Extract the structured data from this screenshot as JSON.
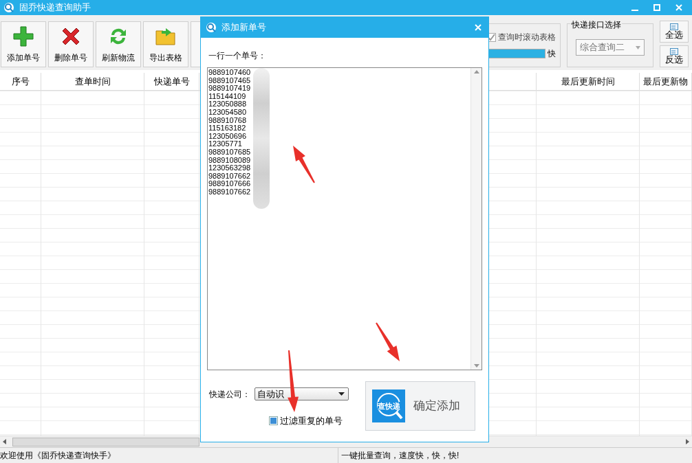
{
  "window": {
    "title": "固乔快递查询助手"
  },
  "toolbar": {
    "buttons": [
      {
        "label": "添加单号",
        "kind": "add"
      },
      {
        "label": "删除单号",
        "kind": "delete"
      },
      {
        "label": "刷新物流",
        "kind": "refresh"
      },
      {
        "label": "导出表格",
        "kind": "export"
      }
    ]
  },
  "options": {
    "scroll_checkbox": {
      "label": "查询时滚动表格",
      "checked": true
    },
    "speed": {
      "level": 1,
      "label": "快"
    },
    "api_group": {
      "title": "快递接口选择",
      "value": "综合查询二"
    },
    "select_buttons": [
      {
        "label": "全选"
      },
      {
        "label": "反选"
      }
    ]
  },
  "table": {
    "columns": [
      "序号",
      "查单时间",
      "快递单号",
      "",
      "最后更新时间",
      "最后更新物"
    ]
  },
  "dialog": {
    "title": "添加新单号",
    "prompt": "一行一个单号：",
    "tracking_numbers": [
      "9889107460",
      "9889107465",
      "9889107419",
      "115144109",
      "123050888",
      "123054580",
      "988910768",
      "115163182",
      "123050696",
      "12305771",
      "9889107685",
      "9889108089",
      "1230563298",
      "9889107662",
      "9889107666",
      "9889107662"
    ],
    "company_label": "快递公司：",
    "company_value": "自动识",
    "dedupe": {
      "label": "过滤重复的单号",
      "checked": true
    },
    "confirm_button": {
      "icon_text": "查快递",
      "label": "确定添加"
    }
  },
  "status_bar": [
    "欢迎使用《固乔快递查询快手》",
    "一键批量查询，速度快，快，快!"
  ]
}
